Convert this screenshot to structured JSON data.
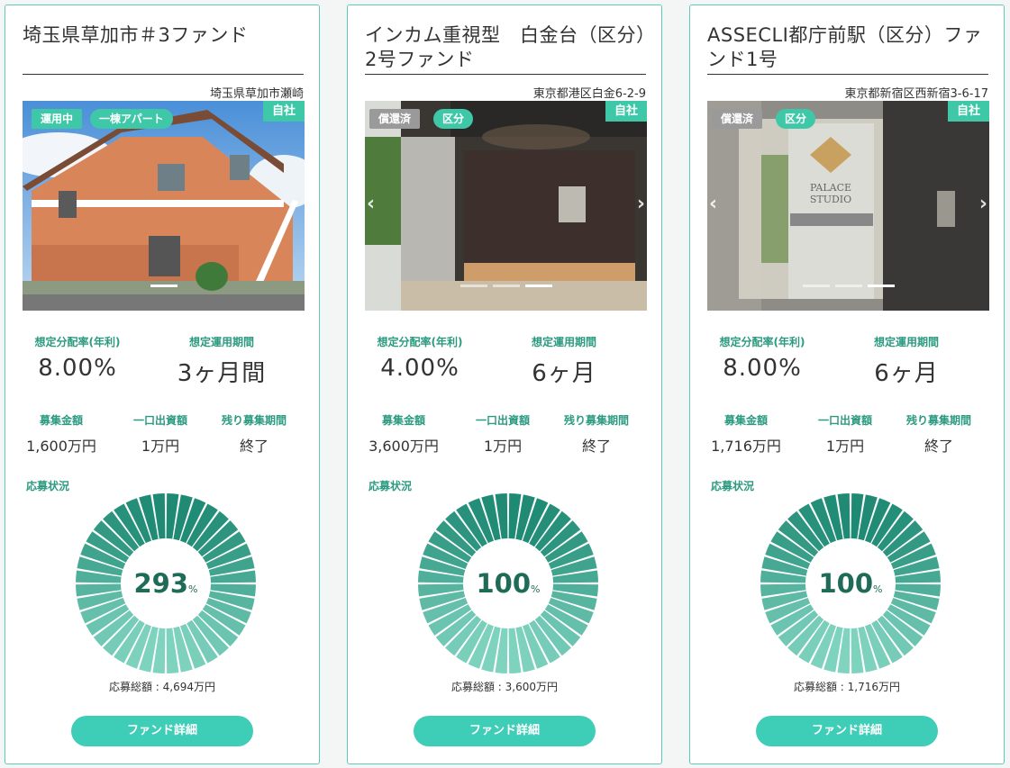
{
  "labels": {
    "yield": "想定分配率(年利)",
    "period": "想定運用期間",
    "raise_amount": "募集金額",
    "min_unit": "一口出資額",
    "remaining": "残り募集期間",
    "apply_status": "応募状況",
    "detail_button": "ファンド詳細",
    "percent_unit": "%"
  },
  "colors": {
    "accent": "#3fc8a8",
    "label_green": "#2b9a80",
    "gauge_dark": "#1f8a74",
    "gauge_light": "#7fd3bf",
    "status_gray": "#9a9a9a"
  },
  "funds": [
    {
      "title": "埼玉県草加市＃3ファンド",
      "address": "埼玉県草加市瀬崎",
      "badge_status": "運用中",
      "badge_status_style": "green",
      "badge_type": "一棟アパート",
      "badge_own": "自社",
      "photo_icon": "apartment-photo",
      "has_arrows": false,
      "yield": "8.00%",
      "period": "3ヶ月間",
      "raise_amount": "1,600万円",
      "min_unit": "1万円",
      "remaining": "終了",
      "apply_percent": "293",
      "apply_total": "応募総額 : 4,694万円",
      "fill_ratio": 1.0
    },
    {
      "title": "インカム重視型　白金台（区分）2号ファンド",
      "address": "東京都港区白金6-2-9",
      "badge_status": "償還済",
      "badge_status_style": "gray",
      "badge_type": "区分",
      "badge_own": "自社",
      "photo_icon": "entrance-photo",
      "has_arrows": true,
      "yield": "4.00%",
      "period": "6ヶ月",
      "raise_amount": "3,600万円",
      "min_unit": "1万円",
      "remaining": "終了",
      "apply_percent": "100",
      "apply_total": "応募総額 : 3,600万円",
      "fill_ratio": 1.0
    },
    {
      "title": "ASSECLI都庁前駅（区分）ファンド1号",
      "address": "東京都新宿区西新宿3-6-17",
      "badge_status": "償還済",
      "badge_status_style": "gray",
      "badge_type": "区分",
      "badge_own": "自社",
      "photo_icon": "sign-photo",
      "has_arrows": true,
      "yield": "8.00%",
      "period": "6ヶ月",
      "raise_amount": "1,716万円",
      "min_unit": "1万円",
      "remaining": "終了",
      "apply_percent": "100",
      "apply_total": "応募総額 : 1,716万円",
      "fill_ratio": 1.0
    }
  ]
}
